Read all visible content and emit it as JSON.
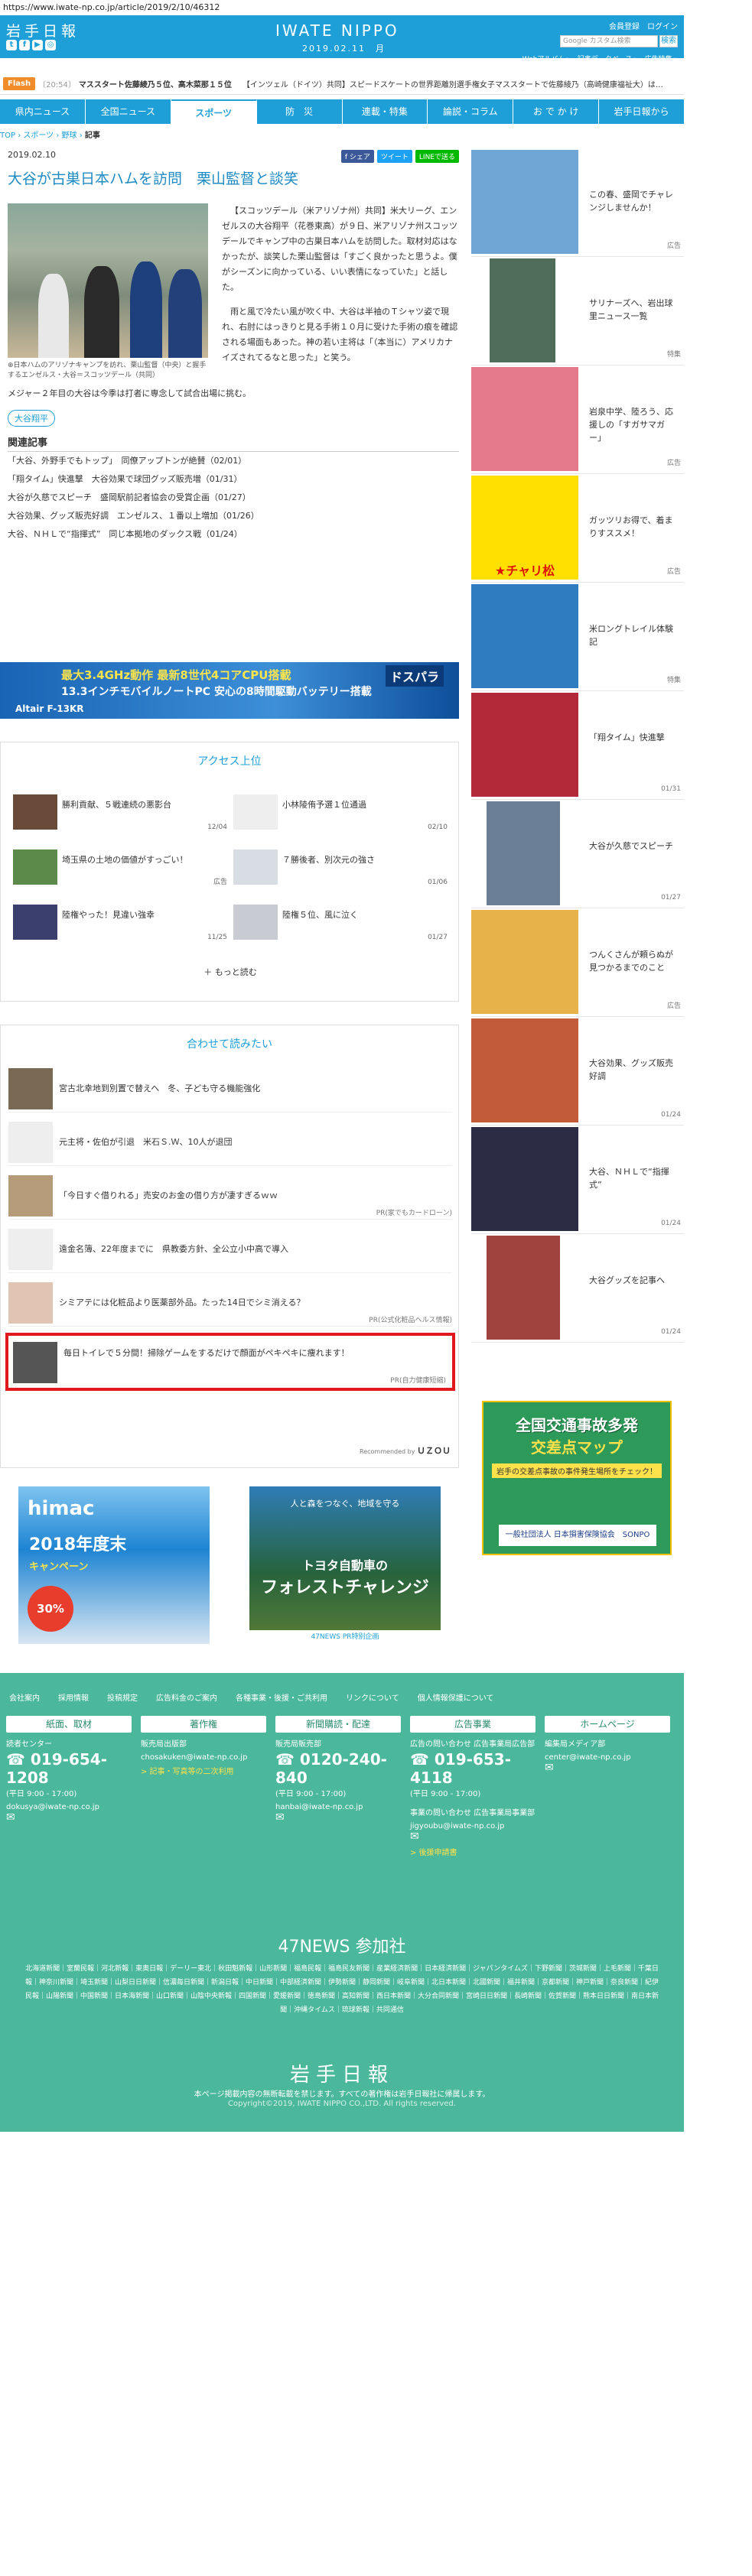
{
  "url": "https://www.iwate-np.co.jp/article/2019/2/10/46312",
  "header": {
    "logo": "岩手日報",
    "brand": "IWATE NIPPO",
    "date": "2019.02.11　月",
    "top_links": "会員登録　ログイン",
    "search_placeholder": "Google カスタム検索",
    "search_button": "検索",
    "sublinks": "Webアルバム ▸　記事データベース ▸　広告特集 ▸"
  },
  "flash": {
    "label": "Flash",
    "items": [
      {
        "time": "〔20:54〕",
        "text": "マススタート佐藤綾乃５位、高木菜那１５位"
      },
      {
        "time": "",
        "text": "【インツェル（ドイツ）共同】スピードスケートの世界距離別選手権女子マススタートで佐藤綾乃（高崎健康福祉大）は…"
      }
    ]
  },
  "nav": {
    "tabs": [
      "県内ニュース",
      "全国ニュース",
      "スポーツ",
      "防　災",
      "連載・特集",
      "論説・コラム",
      "お で か け",
      "岩手日報から"
    ],
    "active": 2
  },
  "breadcrumb": {
    "top": "TOP",
    "sports": "スポーツ",
    "local": "野球",
    "current": "記事"
  },
  "article": {
    "date": "2019.02.10",
    "share": [
      "f シェア",
      "ツイート",
      "LINEで送る"
    ],
    "title": "大谷が古巣日本ハムを訪問　栗山監督と談笑",
    "caption": "日本ハムのアリゾナキャンプを訪れ、栗山監督（中央）と握手するエンゼルス・大谷＝スコッツデール（共同）",
    "p1": "【スコッツデール（米アリゾナ州）共同】米大リーグ、エンゼルスの大谷翔平（花巻東高）が９日、米アリゾナ州スコッツデールでキャンプ中の古巣日本ハムを訪問した。取材対応はなかったが、談笑した栗山監督は「すごく良かったと思うよ。僕がシーズンに向かっている、いい表情になっていた」と話した。",
    "p2": "雨と風で冷たい風が吹く中、大谷は半袖のＴシャツ姿で現れ、右肘にはっきりと見る手術１０月に受けた手術の痕を確認される場面もあった。神の若い主将は「（本当に）アメリカナイズされてるなと思った」と笑う。",
    "after": "メジャー２年目の大谷は今季は打者に専念して試合出場に挑む。",
    "tag": "大谷翔平",
    "related_heading": "関連記事",
    "related": [
      "「大谷、外野手でもトップ」　同僚アップトンが絶賛（02/01）",
      "「翔タイム」快進撃　大谷効果で球団グッズ販売増（01/31）",
      "大谷が久慈でスピーチ　盛岡駅前記者協会の受賞企画（01/27）",
      "大谷効果、グッズ販売好調　エンゼルス、１番以上増加（01/26）",
      "大谷、ＮＨＬで“指揮式”　同じ本拠地のダックス戦（01/24）"
    ]
  },
  "banner_pc": {
    "l1": "最大3.4GHz動作 最新8世代4コアCPU搭載",
    "l2": "13.3インチモバイルノートPC 安心の8時間駆動バッテリー搭載",
    "l3": "Altair F-13KR",
    "brand": "ドスパラ"
  },
  "access": {
    "heading": "アクセス上位",
    "items": [
      {
        "title": "勝利貢献、５戦連続の悪影台",
        "date": "12/04"
      },
      {
        "title": "小林陵侑予選１位通過",
        "date": "02/10"
      },
      {
        "title": "埼玉県の土地の価値がすっごい！",
        "date": "広告"
      },
      {
        "title": "７勝後者、別次元の強さ",
        "date": "01/06"
      },
      {
        "title": "陸権やった！見違い強幸",
        "date": "11/25"
      },
      {
        "title": "陸権５位、風に泣く",
        "date": "01/27"
      }
    ],
    "more": "もっと読む"
  },
  "recommend": {
    "heading": "合わせて読みたい",
    "items": [
      {
        "title": "宮古北幸地到別置で替えへ　冬、子ども守る機能強化",
        "source": ""
      },
      {
        "title": "元主将・佐伯が引退　米石Ｓ.Ｗ、10人が退団",
        "source": ""
      },
      {
        "title": "「今日すぐ借りれる」売安のお金の借り方が凄すぎるｗｗ",
        "source": "PR(家でもカードローン)"
      },
      {
        "title": "遠金名簿、22年度までに　県教委方針、全公立小中高で導入",
        "source": ""
      },
      {
        "title": "シミアテには化粧品より医薬部外品。たった14日でシミ消える？",
        "source": "PR(公式化粧品ヘルス情報)"
      },
      {
        "title": "毎日トイレで５分間！掃除ゲームをするだけで顔面がペキペキに痩れます！",
        "source": "PR(自力健康短縮)"
      }
    ],
    "powered": "Recommended by",
    "powered_brand": "ＵＺＯＵ"
  },
  "sidebar": [
    {
      "title": "この春、盛岡でチャレンジしませんか！",
      "date": "広告"
    },
    {
      "title": "サリナーズへ、岩出球里ニュース一覧",
      "date": "特集"
    },
    {
      "title": "岩泉中学、陸ろう、応援しの「すガサマガー」",
      "date": "広告"
    },
    {
      "title": "ガッツリお得で、着まりすススメ！",
      "date": "広告"
    },
    {
      "title": "米ロングトレイル体験記",
      "date": "特集"
    },
    {
      "title": "「翔タイム」快進撃",
      "date": "01/31"
    },
    {
      "title": "大谷が久慈でスピーチ",
      "date": "01/27"
    },
    {
      "title": "つんくさんが頼らぬが見つかるまでのこと",
      "date": "広告"
    },
    {
      "title": "大谷効果、グッズ販売好調",
      "date": "01/24"
    },
    {
      "title": "大谷、ＮＨＬで“指揮式”",
      "date": "01/24"
    },
    {
      "title": "大谷グッズを記事へ",
      "date": "01/24"
    }
  ],
  "ad_map": {
    "l1": "全国交通事故多発",
    "l2": "交差点マップ",
    "l3": "岩手の交差点事故の事件発生場所をチェック！",
    "l4": "一般社団法人 日本損害保険協会　SONPO"
  },
  "ad_himac": {
    "l1": "himac",
    "l2": "2018年度末",
    "l3": "キャンペーン",
    "l4": "30% OFF"
  },
  "ad_toyota": {
    "l1": "人と森をつなぐ、地域を守る",
    "l2": "トヨタ自動車の",
    "l3": "フォレストチャレンジ",
    "l4": "47NEWS PR特別企画"
  },
  "footer": {
    "links": [
      "会社案内",
      "採用情報",
      "投稿規定",
      "広告料金のご案内",
      "各種事業・後援・ご共利用",
      "リンクについて",
      "個人情報保護について"
    ],
    "cols": [
      {
        "head": "紙面、取材",
        "sub": "読者センター",
        "tel": "019-654-1208",
        "hour": "(平日 9:00 - 17:00)",
        "mail": "dokusya@iwate-np.co.jp",
        "link": "",
        "sub2": ""
      },
      {
        "head": "著作権",
        "sub": "販売局出版部",
        "tel": "",
        "hour": "",
        "mail": "chosakuken@iwate-np.co.jp",
        "link": "> 記事・写真等の二次利用",
        "sub2": ""
      },
      {
        "head": "新聞購読・配達",
        "sub": "販売局販売部",
        "tel": "0120-240-840",
        "hour": "(平日 9:00 - 17:00)",
        "mail": "hanbai@iwate-np.co.jp",
        "link": "",
        "sub2": ""
      },
      {
        "head": "広告事業",
        "sub": "広告の問い合わせ 広告事業局広告部",
        "tel": "019-653-4118",
        "hour": "(平日 9:00 - 17:00)",
        "mail": "jigyoubu@iwate-np.co.jp",
        "link": "> 後援申請書",
        "sub2": "事業の問い合わせ 広告事業局事業部"
      },
      {
        "head": "ホームページ",
        "sub": "編集局メディア部",
        "tel": "",
        "hour": "",
        "mail": "center@iwate-np.co.jp",
        "link": "",
        "sub2": ""
      }
    ],
    "sankasha": "47NEWS 参加社",
    "papers": "北海道新聞｜室蘭民報｜河北新報｜東奥日報｜デーリー東北｜秋田魁新報｜山形新聞｜福島民報｜福島民友新聞｜産業経済新聞｜日本経済新聞｜ジャパンタイムズ｜下野新聞｜茨城新聞｜上毛新聞｜千葉日報｜神奈川新聞｜埼玉新聞｜山梨日日新聞｜信濃毎日新聞｜新潟日報｜中日新聞｜中部経済新聞｜伊勢新聞｜静岡新聞｜岐阜新聞｜北日本新聞｜北國新聞｜福井新聞｜京都新聞｜神戸新聞｜奈良新聞｜紀伊民報｜山陽新聞｜中国新聞｜日本海新聞｜山口新聞｜山陰中央新報｜四国新聞｜愛媛新聞｜徳島新聞｜高知新聞｜西日本新聞｜大分合同新聞｜宮崎日日新聞｜長崎新聞｜佐賀新聞｜熊本日日新聞｜南日本新聞｜沖縄タイムス｜琉球新報｜共同通信",
    "logo": "岩手日報",
    "note": "本ページ掲載内容の無断転載を禁じます。すべての著作権は岩手日報社に帰属します。",
    "copy": "Copyright©2019, IWATE NIPPO CO.,LTD. All rights reserved."
  }
}
